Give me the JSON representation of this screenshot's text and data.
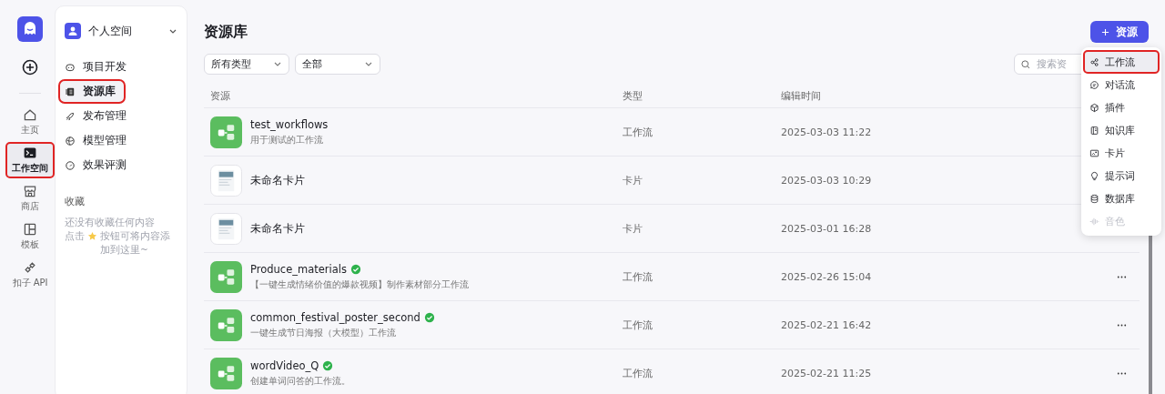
{
  "rail": {
    "items": [
      {
        "label": "主页",
        "selected": false,
        "highlighted": false
      },
      {
        "label": "工作空间",
        "selected": true,
        "highlighted": true
      },
      {
        "label": "商店",
        "selected": false,
        "highlighted": false
      },
      {
        "label": "模板",
        "selected": false,
        "highlighted": false
      },
      {
        "label": "扣子 API",
        "selected": false,
        "highlighted": false
      }
    ]
  },
  "sidebar": {
    "space": "个人空间",
    "items": [
      {
        "label": "项目开发",
        "selected": false,
        "highlighted": false
      },
      {
        "label": "资源库",
        "selected": true,
        "highlighted": true
      },
      {
        "label": "发布管理",
        "selected": false,
        "highlighted": false
      },
      {
        "label": "模型管理",
        "selected": false,
        "highlighted": false
      },
      {
        "label": "效果评测",
        "selected": false,
        "highlighted": false
      }
    ],
    "favorites": {
      "title": "收藏",
      "empty": "还没有收藏任何内容",
      "hint_before": "点击",
      "hint_after": "按钮可将内容添加到这里~"
    }
  },
  "main": {
    "title": "资源库",
    "add_button": "资源",
    "filters": [
      {
        "value": "所有类型"
      },
      {
        "value": "全部"
      }
    ],
    "search": {
      "placeholder": "搜索资"
    },
    "table": {
      "columns": [
        "资源",
        "类型",
        "编辑时间"
      ],
      "rows": [
        {
          "kind": "workflow",
          "name": "test_workflows",
          "description": "用于测试的工作流",
          "verified": false,
          "type": "工作流",
          "time": "2025-03-03 11:22"
        },
        {
          "kind": "card",
          "name": "未命名卡片",
          "verified": false,
          "type": "卡片",
          "time": "2025-03-03 10:29"
        },
        {
          "kind": "card",
          "name": "未命名卡片",
          "verified": false,
          "type": "卡片",
          "time": "2025-03-01 16:28"
        },
        {
          "kind": "workflow",
          "name": "Produce_materials",
          "description": "【一键生成情绪价值的爆款视频】制作素材部分工作流",
          "verified": true,
          "type": "工作流",
          "time": "2025-02-26 15:04"
        },
        {
          "kind": "workflow",
          "name": "common_festival_poster_second",
          "description": "一键生成节日海报（大模型）工作流",
          "verified": true,
          "type": "工作流",
          "time": "2025-02-21 16:42"
        },
        {
          "kind": "workflow",
          "name": "wordVideo_Q",
          "description": "创建单词问答的工作流。",
          "verified": true,
          "type": "工作流",
          "time": "2025-02-21 11:25"
        }
      ]
    },
    "menu": {
      "items": [
        {
          "label": "工作流",
          "selected": true,
          "highlighted": true,
          "disabled": false
        },
        {
          "label": "对话流",
          "selected": false,
          "highlighted": false,
          "disabled": false
        },
        {
          "label": "插件",
          "selected": false,
          "highlighted": false,
          "disabled": false
        },
        {
          "label": "知识库",
          "selected": false,
          "highlighted": false,
          "disabled": false
        },
        {
          "label": "卡片",
          "selected": false,
          "highlighted": false,
          "disabled": false
        },
        {
          "label": "提示词",
          "selected": false,
          "highlighted": false,
          "disabled": false
        },
        {
          "label": "数据库",
          "selected": false,
          "highlighted": false,
          "disabled": false
        },
        {
          "label": "音色",
          "selected": false,
          "highlighted": false,
          "disabled": true
        }
      ]
    }
  }
}
